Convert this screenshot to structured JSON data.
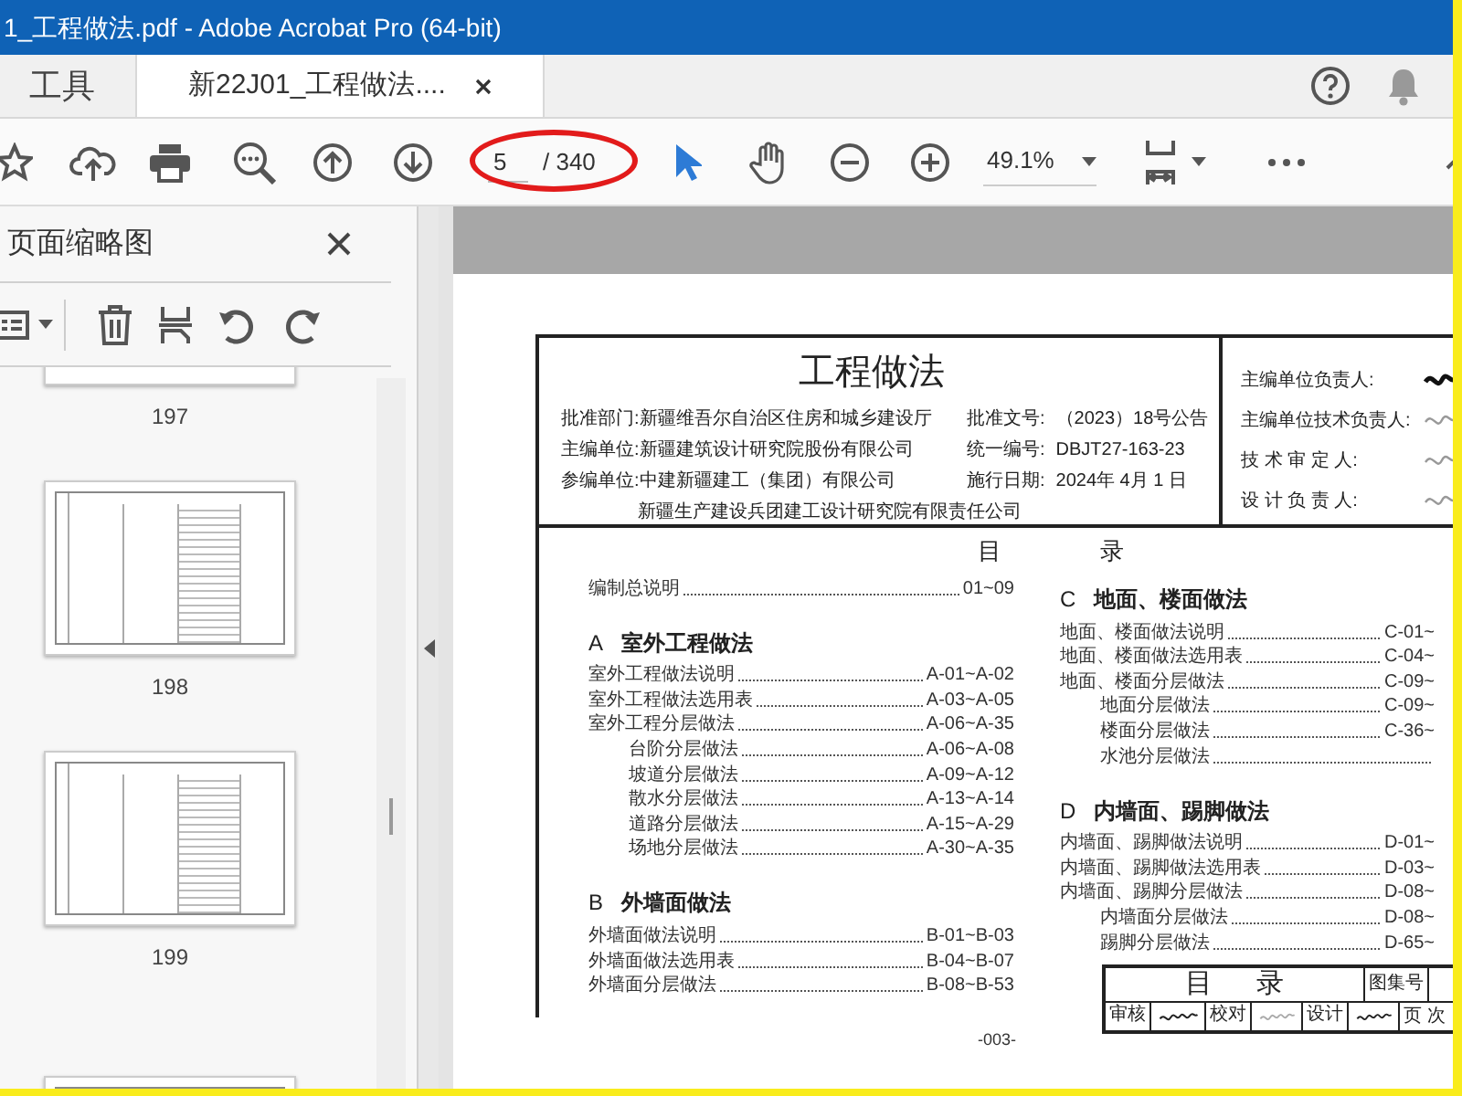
{
  "window": {
    "title": "1_工程做法.pdf - Adobe Acrobat Pro (64-bit)"
  },
  "tabs": [
    {
      "label": "工具",
      "selected": false
    },
    {
      "label": "新22J01_工程做法....",
      "selected": true
    }
  ],
  "toolbar": {
    "page_current": "5",
    "page_total": "/ 340",
    "zoom": "49.1%"
  },
  "sidebar": {
    "title": "页面缩略图",
    "thumbnails": [
      {
        "label": "197",
        "kind": "tail"
      },
      {
        "label": "198",
        "kind": "full"
      },
      {
        "label": "199",
        "kind": "full"
      },
      {
        "kind": "head"
      }
    ]
  },
  "document": {
    "title": "工程做法",
    "info_left": [
      {
        "label": "批准部门:",
        "values": [
          "新疆维吾尔自治区住房和城乡建设厅"
        ]
      },
      {
        "label": "主编单位:",
        "values": [
          "新疆建筑设计研究院股份有限公司"
        ]
      },
      {
        "label": "参编单位:",
        "values": [
          "中建新疆建工（集团）有限公司",
          "新疆生产建设兵团建工设计研究院有限责任公司"
        ]
      }
    ],
    "info_right": [
      {
        "label": "批准文号:",
        "value": "（2023）18号公告"
      },
      {
        "label": "统一编号:",
        "value": "DBJT27-163-23"
      },
      {
        "label": "施行日期:",
        "value": "2024年 4月 1 日"
      }
    ],
    "responsible": [
      {
        "label": "主编单位负责人:"
      },
      {
        "label": "主编单位技术负责人:"
      },
      {
        "label": "技 术 审 定 人:"
      },
      {
        "label": "设 计 负 责 人:"
      }
    ],
    "toc_heading": "目 录",
    "toc_columns": [
      [
        {
          "kind": "entry",
          "title": "编制总说明",
          "pages": "01~09"
        },
        {
          "kind": "section",
          "letter": "A",
          "title": "室外工程做法",
          "entries": [
            {
              "title": "室外工程做法说明",
              "pages": "A-01~A-02"
            },
            {
              "title": "室外工程做法选用表",
              "pages": "A-03~A-05"
            },
            {
              "title": "室外工程分层做法",
              "pages": "A-06~A-35",
              "children": [
                {
                  "title": "台阶分层做法",
                  "pages": "A-06~A-08"
                },
                {
                  "title": "坡道分层做法",
                  "pages": "A-09~A-12"
                },
                {
                  "title": "散水分层做法",
                  "pages": "A-13~A-14"
                },
                {
                  "title": "道路分层做法",
                  "pages": "A-15~A-29"
                },
                {
                  "title": "场地分层做法",
                  "pages": "A-30~A-35"
                }
              ]
            }
          ]
        },
        {
          "kind": "section",
          "letter": "B",
          "title": "外墙面做法",
          "entries": [
            {
              "title": "外墙面做法说明",
              "pages": "B-01~B-03"
            },
            {
              "title": "外墙面做法选用表",
              "pages": "B-04~B-07"
            },
            {
              "title": "外墙面分层做法",
              "pages": "B-08~B-53"
            }
          ]
        }
      ],
      [
        {
          "kind": "section",
          "letter": "C",
          "title": "地面、楼面做法",
          "entries": [
            {
              "title": "地面、楼面做法说明",
              "pages": "C-01~"
            },
            {
              "title": "地面、楼面做法选用表",
              "pages": "C-04~"
            },
            {
              "title": "地面、楼面分层做法",
              "pages": "C-09~",
              "children": [
                {
                  "title": "地面分层做法",
                  "pages": "C-09~"
                },
                {
                  "title": "楼面分层做法",
                  "pages": "C-36~"
                },
                {
                  "title": "水池分层做法"
                }
              ]
            }
          ]
        },
        {
          "kind": "section",
          "letter": "D",
          "title": "内墙面、踢脚做法",
          "entries": [
            {
              "title": "内墙面、踢脚做法说明",
              "pages": "D-01~"
            },
            {
              "title": "内墙面、踢脚做法选用表",
              "pages": "D-03~"
            },
            {
              "title": "内墙面、踢脚分层做法",
              "pages": "D-08~",
              "children": [
                {
                  "title": "内墙面分层做法",
                  "pages": "D-08~"
                },
                {
                  "title": "踢脚分层做法",
                  "pages": "D-65~"
                }
              ]
            }
          ]
        }
      ]
    ],
    "title_block": {
      "title": "目 录",
      "set_label": "图集号",
      "review": "审核",
      "check": "校对",
      "design": "设计",
      "page_label": "页 次"
    },
    "page_number": "-003-"
  }
}
